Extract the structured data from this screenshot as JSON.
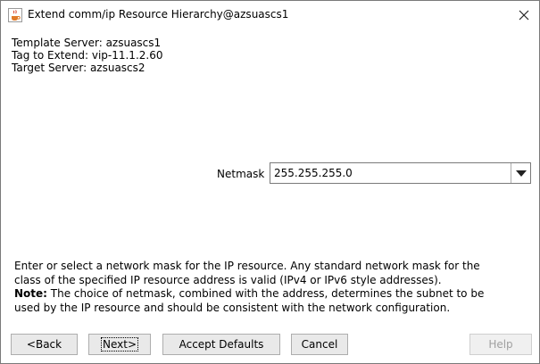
{
  "window": {
    "title": "Extend comm/ip Resource Hierarchy@azsuascs1"
  },
  "info": {
    "template_server": "Template Server: azsuascs1",
    "tag_to_extend": "Tag to Extend: vip-11.1.2.60",
    "target_server": "Target Server: azsuascs2"
  },
  "netmask": {
    "label": "Netmask",
    "value": "255.255.255.0"
  },
  "description": {
    "line1": "Enter or select a network mask for the IP resource. Any standard network mask for the",
    "line2": "class of the specified IP resource address is valid (IPv4 or IPv6 style addresses).",
    "note_label": "Note:",
    "note_text": " The choice of netmask, combined with the address, determines the subnet to be",
    "line4": "used by the IP resource and should be consistent with the network configuration."
  },
  "buttons": {
    "back": "<Back",
    "next": "Next>",
    "accept_defaults": "Accept Defaults",
    "cancel": "Cancel",
    "help": "Help"
  },
  "icons": {
    "app": "java-coffee-cup-icon",
    "close": "close-icon",
    "dropdown": "chevron-down-icon"
  }
}
